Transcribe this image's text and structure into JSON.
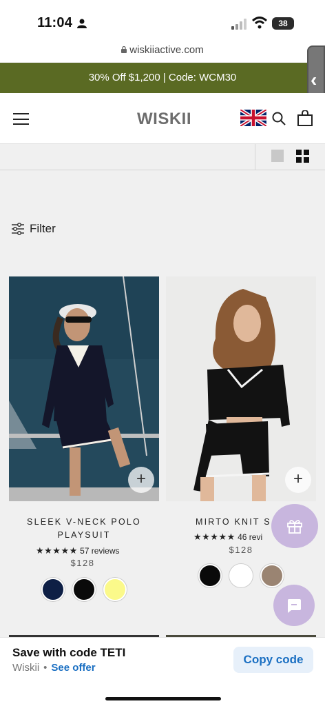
{
  "status": {
    "time": "11:04",
    "battery": "38"
  },
  "browser": {
    "url": "wiskiiactive.com"
  },
  "promo": {
    "text": "30% Off $1,200 | Code: WCM30"
  },
  "header": {
    "logo": "WISKII"
  },
  "filter": {
    "label": "Filter"
  },
  "products": [
    {
      "title": "SLEEK V-NECK POLO PLAYSUIT",
      "stars": "★★★★★",
      "reviews": "57 reviews",
      "price": "$128",
      "swatches": [
        "#0e1f45",
        "#0a0a0a",
        "#fbf98a"
      ]
    },
    {
      "title": "MIRTO KNIT S",
      "stars": "★★★★★",
      "reviews": "46 revi",
      "price": "$128",
      "swatches": [
        "#0a0a0a",
        "#ffffff",
        "#9a8472"
      ]
    }
  ],
  "offer": {
    "title": "Save with code TETI",
    "brand": "Wiskii",
    "separator": "•",
    "link": "See offer",
    "copy_label": "Copy code"
  }
}
